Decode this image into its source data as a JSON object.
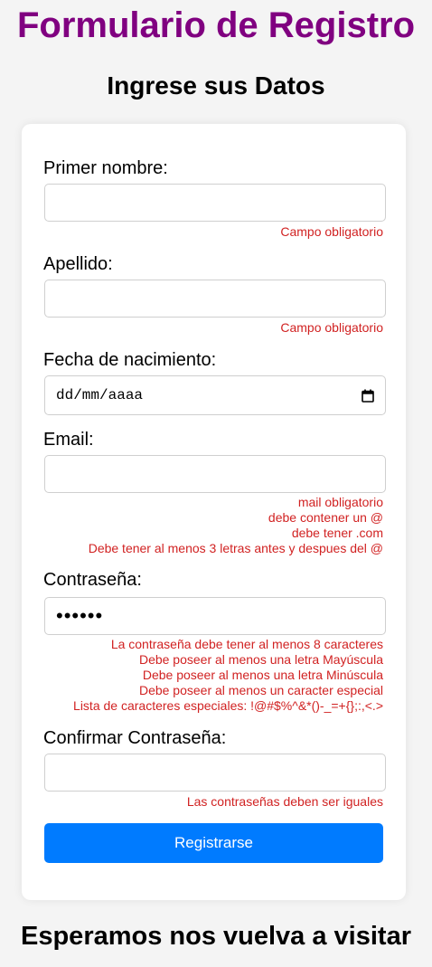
{
  "header": {
    "title": "Formulario de Registro",
    "subtitle": "Ingrese sus Datos"
  },
  "form": {
    "first_name": {
      "label": "Primer nombre:",
      "value": "",
      "errors": [
        "Campo obligatorio"
      ]
    },
    "last_name": {
      "label": "Apellido:",
      "value": "",
      "errors": [
        "Campo obligatorio"
      ]
    },
    "birth_date": {
      "label": "Fecha de nacimiento:",
      "placeholder": "dd/mm/aaaa",
      "icon": "calendar-icon"
    },
    "email": {
      "label": "Email:",
      "value": "",
      "errors": [
        "mail obligatorio",
        "debe contener un @",
        "debe tener .com",
        "Debe tener al menos 3 letras antes y despues del @"
      ]
    },
    "password": {
      "label": "Contraseña:",
      "masked_value": "••••••",
      "errors": [
        "La contraseña debe tener al menos 8 caracteres",
        "Debe poseer al menos una letra Mayúscula",
        "Debe poseer al menos una letra Minúscula",
        "Debe poseer al menos un caracter especial",
        "Lista de caracteres especiales: !@#$%^&*()-_=+{};:,<.>"
      ]
    },
    "confirm_password": {
      "label": "Confirmar Contraseña:",
      "value": "",
      "errors": [
        "Las contraseñas deben ser iguales"
      ]
    },
    "submit_label": "Registrarse"
  },
  "footer": {
    "text": "Esperamos nos vuelva a visitar"
  },
  "colors": {
    "title": "#800080",
    "error": "#d12222",
    "button": "#007bff",
    "background": "#f4f4f4",
    "card": "#ffffff"
  }
}
